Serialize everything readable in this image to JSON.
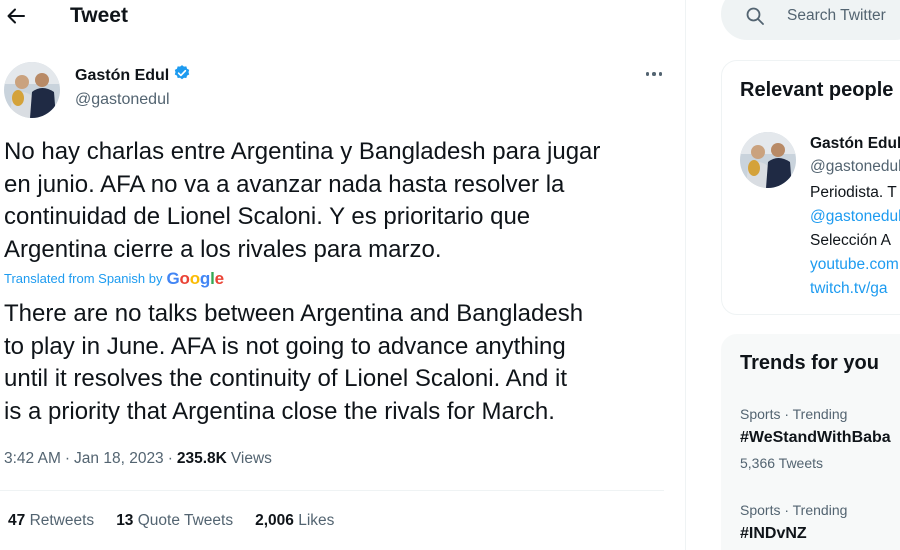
{
  "header": {
    "title": "Tweet"
  },
  "tweet": {
    "author_name": "Gastón Edul",
    "author_handle": "@gastonedul",
    "text": "No hay charlas entre Argentina y Bangladesh para jugar\nen junio. AFA no va a avanzar nada hasta resolver la\ncontinuidad de Lionel Scaloni. Y es prioritario que\nArgentina cierre a los rivales para marzo.",
    "translated_label": "Translated from Spanish by",
    "translator_brand": {
      "G": "G",
      "o1": "o",
      "o2": "o",
      "g": "g",
      "l": "l",
      "e": "e"
    },
    "translation": "There are no talks between Argentina and Bangladesh\nto play in June. AFA is not going to advance anything\nuntil it resolves the continuity of Lionel Scaloni. And it\nis a priority that Argentina close the rivals for March.",
    "time": "3:42 AM",
    "separator": "·",
    "date": "Jan 18, 2023",
    "views_count": "235.8K",
    "views_label": "Views",
    "retweets_count": "47",
    "retweets_label": "Retweets",
    "quotes_count": "13",
    "quotes_label": "Quote Tweets",
    "likes_count": "2,006",
    "likes_label": "Likes"
  },
  "sidebar": {
    "search_placeholder": "Search Twitter",
    "relevant": {
      "title": "Relevant people",
      "name": "Gastón Edul",
      "handle": "@gastonedul",
      "bio_lines": [
        "Periodista. T",
        "@gastonedul",
        "Selección A",
        "youtube.com",
        "twitch.tv/ga"
      ]
    },
    "trends": {
      "title": "Trends for you",
      "items": [
        {
          "category": "Sports · Trending",
          "name": "#WeStandWithBaba",
          "count": "5,366 Tweets"
        },
        {
          "category": "Sports · Trending",
          "name": "#INDvNZ",
          "count": ""
        }
      ]
    }
  },
  "colors": {
    "accent": "#1d9bf0",
    "text": "#0f1419",
    "secondary": "#536471",
    "verified": "#1d9bf0"
  },
  "icons": [
    "back-arrow-icon",
    "verified-badge-icon",
    "more-icon",
    "search-icon"
  ]
}
